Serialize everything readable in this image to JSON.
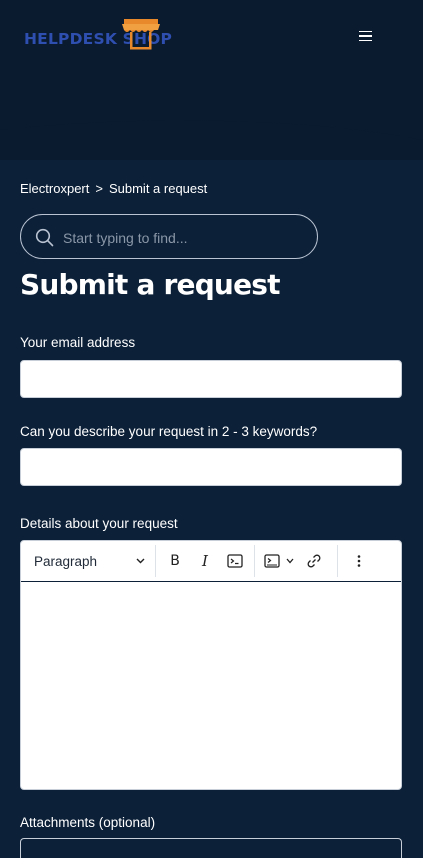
{
  "header": {
    "logo_text": "HELPDESK SHOP",
    "logo_color": "#2f4fb0",
    "logo_accent": "#e8892c",
    "menu_icon": "hamburger-icon"
  },
  "breadcrumb": {
    "items": [
      "Electroxpert",
      "Submit a request"
    ],
    "separator": ">"
  },
  "search": {
    "placeholder": "Start typing to find...",
    "value": ""
  },
  "page": {
    "title": "Submit a request"
  },
  "form": {
    "email_label": "Your email address",
    "email_value": "",
    "keywords_label": "Can you describe your request in 2 - 3 keywords?",
    "keywords_value": "",
    "details_label": "Details about your request",
    "attachments_label": "Attachments (optional)"
  },
  "editor": {
    "block_format": "Paragraph",
    "tools": [
      "bold-icon",
      "italic-icon",
      "code-icon",
      "code-block-icon",
      "link-icon",
      "more-vertical-icon"
    ],
    "bold_glyph": "B",
    "italic_glyph": "I"
  },
  "colors": {
    "page_bg": "#0c2038",
    "header_bg": "#0a1a2f"
  }
}
